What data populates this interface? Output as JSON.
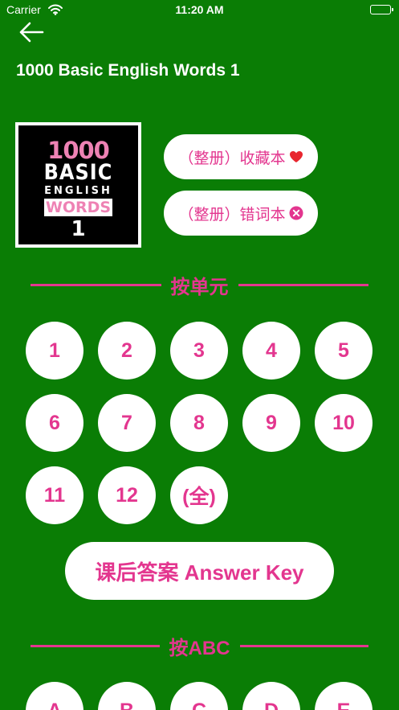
{
  "status_bar": {
    "carrier": "Carrier",
    "time": "11:20 AM"
  },
  "header": {
    "title": "1000 Basic English Words 1"
  },
  "cover": {
    "line1": "1000",
    "line2": "BASIC",
    "line3": "ENGLISH",
    "line4": "WORDS",
    "line5": "1"
  },
  "favorites_button": {
    "label": "（整册）收藏本",
    "icon": "heart-icon",
    "icon_color": "#e8262f"
  },
  "wrong_words_button": {
    "label": "（整册）错词本",
    "icon": "close-circle-icon",
    "icon_color": "#e3368f"
  },
  "unit_section": {
    "title": "按单元"
  },
  "units": [
    "1",
    "2",
    "3",
    "4",
    "5",
    "6",
    "7",
    "8",
    "9",
    "10",
    "11",
    "12",
    "(全)"
  ],
  "answer_key_button": {
    "label": "课后答案 Answer Key"
  },
  "abc_section": {
    "title": "按ABC"
  },
  "letters": [
    "A",
    "B",
    "C",
    "D",
    "E"
  ],
  "colors": {
    "background": "#0a7d05",
    "accent": "#e3368f",
    "button_bg": "#ffffff"
  }
}
